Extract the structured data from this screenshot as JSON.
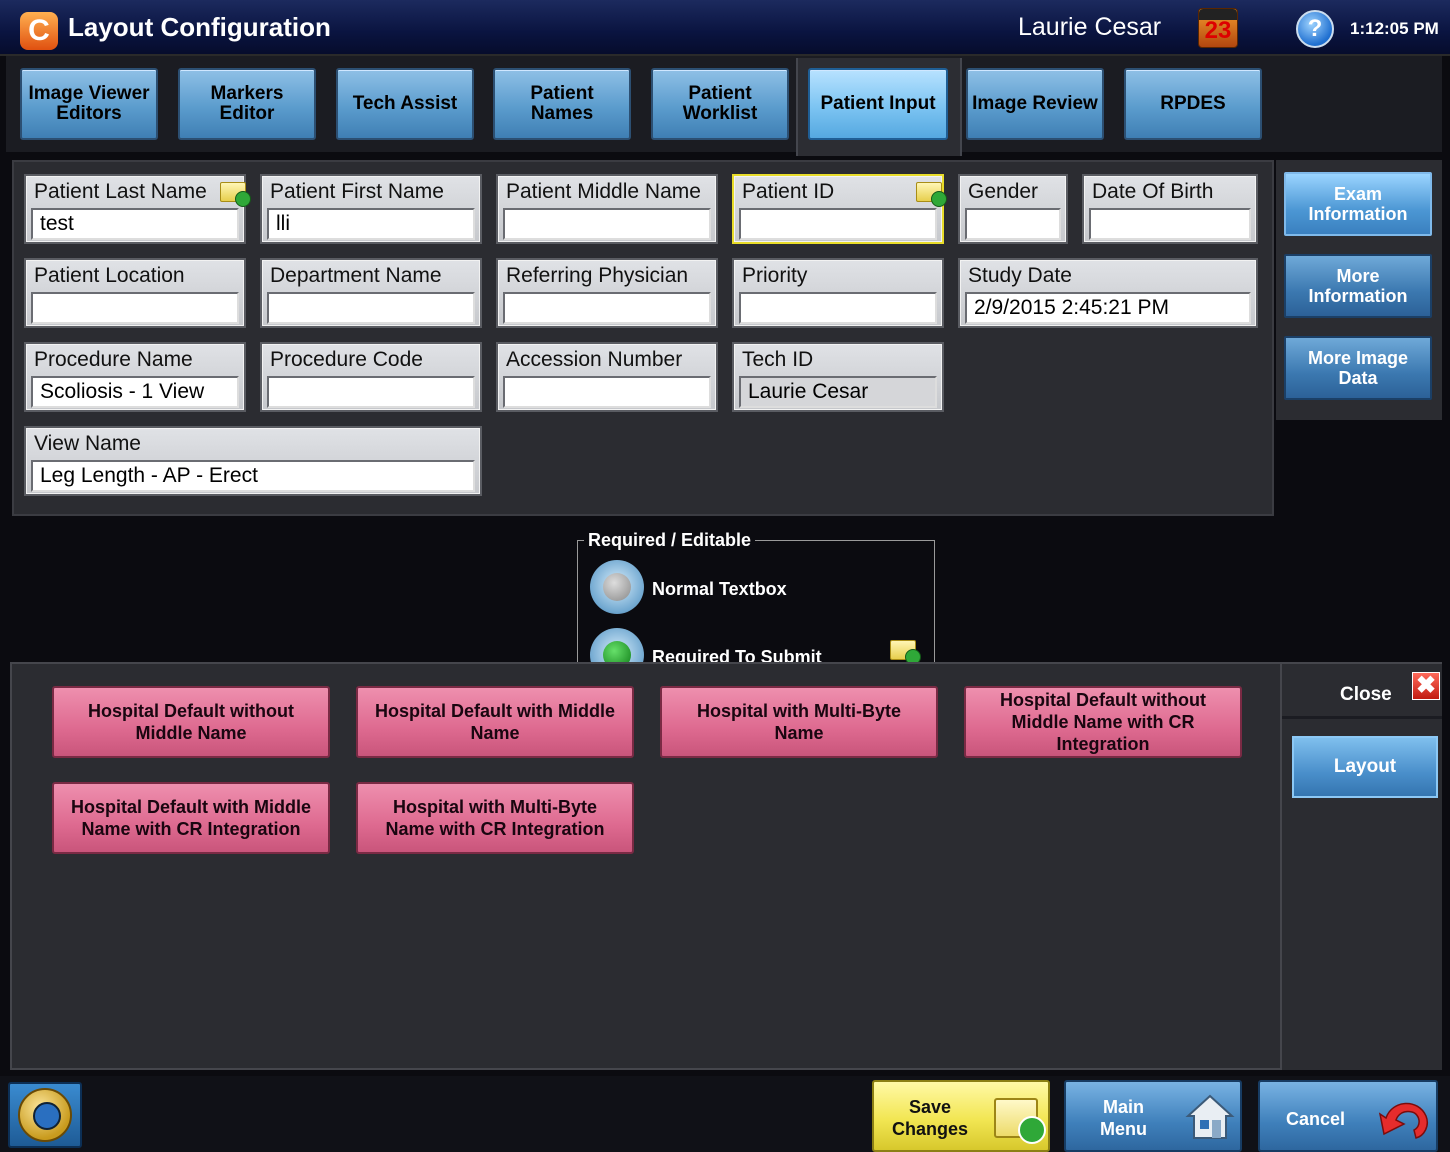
{
  "titlebar": {
    "title": "Layout Configuration",
    "logo_letter": "C",
    "user": "Laurie Cesar",
    "calendar_day": "23",
    "help_symbol": "?",
    "time": "1:12:05 PM"
  },
  "tabs": [
    {
      "label": "Image Viewer Editors"
    },
    {
      "label": "Markers Editor"
    },
    {
      "label": "Tech Assist"
    },
    {
      "label": "Patient Names"
    },
    {
      "label": "Patient Worklist"
    },
    {
      "label": "Patient Input",
      "active": true
    },
    {
      "label": "Image Review"
    },
    {
      "label": "RPDES"
    }
  ],
  "fields": {
    "last_name": {
      "label": "Patient Last Name",
      "value": "test",
      "required": true
    },
    "first_name": {
      "label": "Patient First Name",
      "value": "lli"
    },
    "middle_name": {
      "label": "Patient Middle Name",
      "value": ""
    },
    "patient_id": {
      "label": "Patient ID",
      "value": "",
      "required": true
    },
    "gender": {
      "label": "Gender",
      "value": ""
    },
    "dob": {
      "label": "Date Of Birth",
      "value": ""
    },
    "location": {
      "label": "Patient Location",
      "value": ""
    },
    "department": {
      "label": "Department Name",
      "value": ""
    },
    "referring": {
      "label": "Referring Physician",
      "value": ""
    },
    "priority": {
      "label": "Priority",
      "value": ""
    },
    "study_date": {
      "label": "Study Date",
      "value": "2/9/2015 2:45:21 PM"
    },
    "procedure_name": {
      "label": "Procedure Name",
      "value": "Scoliosis - 1 View"
    },
    "procedure_code": {
      "label": "Procedure Code",
      "value": ""
    },
    "accession": {
      "label": "Accession Number",
      "value": ""
    },
    "tech_id": {
      "label": "Tech ID",
      "value": "Laurie Cesar"
    },
    "view_name": {
      "label": "View Name",
      "value": "Leg Length - AP - Erect"
    }
  },
  "side_buttons": {
    "exam": "Exam Information",
    "more_info": "More Information",
    "more_image": "More Image Data"
  },
  "legend": {
    "title": "Required / Editable",
    "normal": "Normal Textbox",
    "required": "Required To Submit"
  },
  "layouts": [
    "Hospital Default without Middle Name",
    "Hospital Default with Middle Name",
    "Hospital with Multi-Byte Name",
    "Hospital Default without Middle Name with CR Integration",
    "Hospital Default with Middle Name with CR Integration",
    "Hospital with Multi-Byte Name with CR Integration"
  ],
  "close_panel": {
    "close_label": "Close",
    "close_symbol": "✖",
    "layout_label": "Layout"
  },
  "bottom": {
    "save_line1": "Save",
    "save_line2": "Changes",
    "main_line1": "Main",
    "main_line2": "Menu",
    "cancel": "Cancel"
  },
  "colors": {
    "tab_blue": "#5b9ccd",
    "layout_pink": "#de6a90",
    "save_yellow": "#f2e653",
    "required_highlight": "#e8dc2a"
  },
  "icons": [
    "app-logo-icon",
    "calendar-icon",
    "help-icon",
    "folder-check-icon",
    "close-icon",
    "home-icon",
    "house-icon",
    "undo-icon"
  ]
}
